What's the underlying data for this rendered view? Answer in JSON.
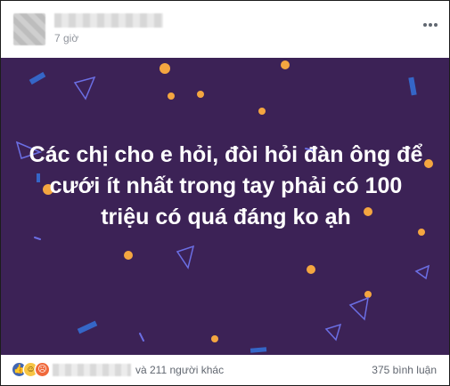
{
  "post": {
    "timestamp": "7 giờ",
    "author_name": "",
    "text": "Các chị cho e hỏi, đòi hỏi đàn ông để cưới ít nhất trong tay phải có 100 triệu có quá đáng ko ạh",
    "background_color": "#3c2256"
  },
  "footer": {
    "reactions": [
      "like-icon",
      "haha-icon",
      "angry-icon"
    ],
    "reactors_text": "và 211 người khác",
    "comments_text": "375 bình luận"
  },
  "colors": {
    "shape_blue": "#2f5bbd",
    "shape_orange": "#f0a040",
    "text_muted": "#616770"
  }
}
